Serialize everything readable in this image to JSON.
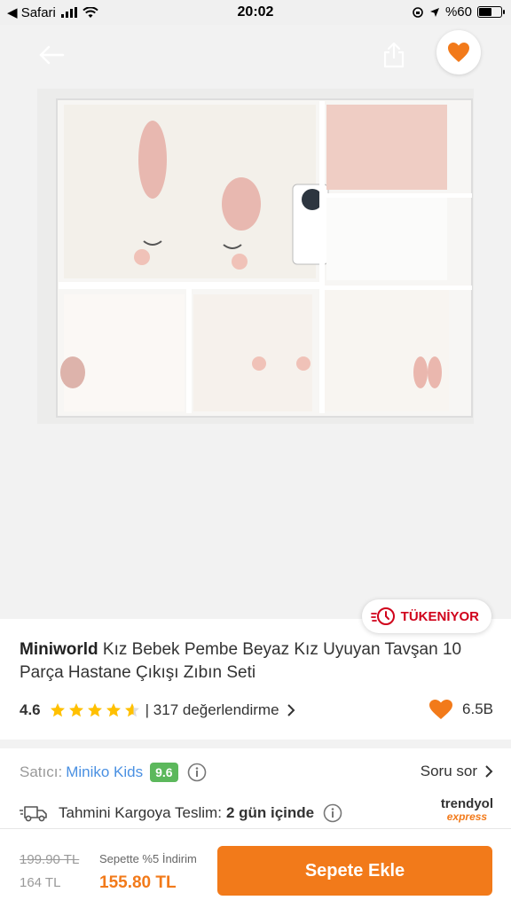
{
  "status_bar": {
    "back_app": "◀ Safari",
    "time": "20:02",
    "battery": "%60",
    "battery_level": 0.6
  },
  "product": {
    "brand": "Miniworld",
    "title": " Kız Bebek Pembe Beyaz Kız Uyuyan Tavşan 10 Parça Hastane Çıkışı Zıbın Seti",
    "stock_badge": "TÜKENİYOR",
    "rating_score": "4.6",
    "rating_value": 4.6,
    "review_count": "| 317 değerlendirme",
    "favorite_count": "6.5B"
  },
  "seller": {
    "label": "Satıcı:",
    "name": "Miniko Kids",
    "score": "9.6",
    "ask_label": "Soru sor"
  },
  "cargo": {
    "label": "Tahmini Kargoya Teslim:",
    "days": "2 gün içinde",
    "logo_line1": "trendyol",
    "logo_line2": "express"
  },
  "bottom_bar": {
    "old_price": "199.90 TL",
    "list_price": "164 TL",
    "discount_label": "Sepette %5 İndirim",
    "final_price": "155.80 TL",
    "add_to_cart": "Sepete Ekle"
  },
  "colors": {
    "accent": "#f27a1a",
    "stock_red": "#d0021b",
    "seller_blue": "#4a90e2",
    "score_green": "#5cb85c"
  }
}
